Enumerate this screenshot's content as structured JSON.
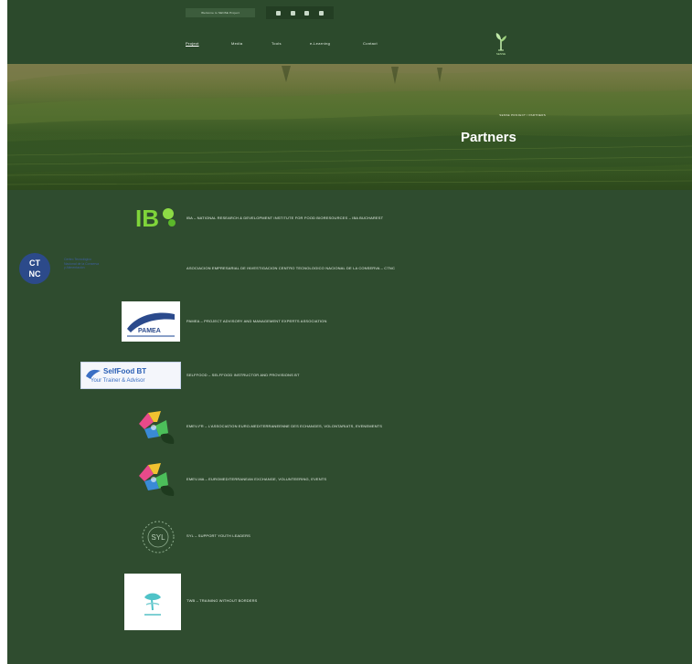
{
  "topbar": {
    "welcome_text": "Welcome to SENSE Project",
    "social_icons": [
      "facebook-icon",
      "twitter-icon",
      "instagram-icon",
      "youtube-icon"
    ]
  },
  "nav": {
    "items": [
      {
        "label": "Project",
        "active": true
      },
      {
        "label": "Media",
        "active": false
      },
      {
        "label": "Tools",
        "active": false
      },
      {
        "label": "e-Learning",
        "active": false
      },
      {
        "label": "Contact",
        "active": false
      }
    ],
    "logo_text": "SENSE"
  },
  "hero": {
    "breadcrumb": "SENSE PROJECT  /  PARTNERS",
    "title": "Partners"
  },
  "partners": [
    {
      "name": "IBA – NATIONAL RESEARCH & DEVELOPMENT INSTITUTE FOR FOOD BIORESOURCES – IBA BUCHAREST",
      "logo": "iba-logo"
    },
    {
      "name": "ASOCIACION EMPRESARIAL DE INVESTIGACION CENTRO TECNOLOGICO NACIONAL DE LA CONSERVA – CTNC",
      "logo": "ctnc-logo",
      "logo_text": [
        "Centro Tecnológico",
        "Nacional de la Conserva",
        "y Alimentación"
      ]
    },
    {
      "name": "PAMEA – PROJECT ADVISORY AND MANAGEMENT EXPERTS ASSOCIATION",
      "logo": "pamea-logo"
    },
    {
      "name": "SELFFOOD – SELFFOOD INSTRUCTOR AND PROVISIONS BT",
      "logo": "selffood-logo",
      "logo_text": [
        "SelfFood BT",
        "Your Trainer & Advisor"
      ]
    },
    {
      "name": "EMEV-FR – L’ASSOCIATION EURO-MEDITERRANEENNE DES ECHANGES, VOLONTARIATS, EVENEMENTS",
      "logo": "emev-fr-logo"
    },
    {
      "name": "EMEV-MA – EUROMEDITERRANEAN EXCHANGE, VOLUNTEERING, EVENTS",
      "logo": "emev-ma-logo"
    },
    {
      "name": "SYL – SUPPORT YOUTH LEADERS",
      "logo": "syl-logo"
    },
    {
      "name": "TWB – TRAINING WITHOUT BORDERS",
      "logo": "twb-logo"
    }
  ]
}
